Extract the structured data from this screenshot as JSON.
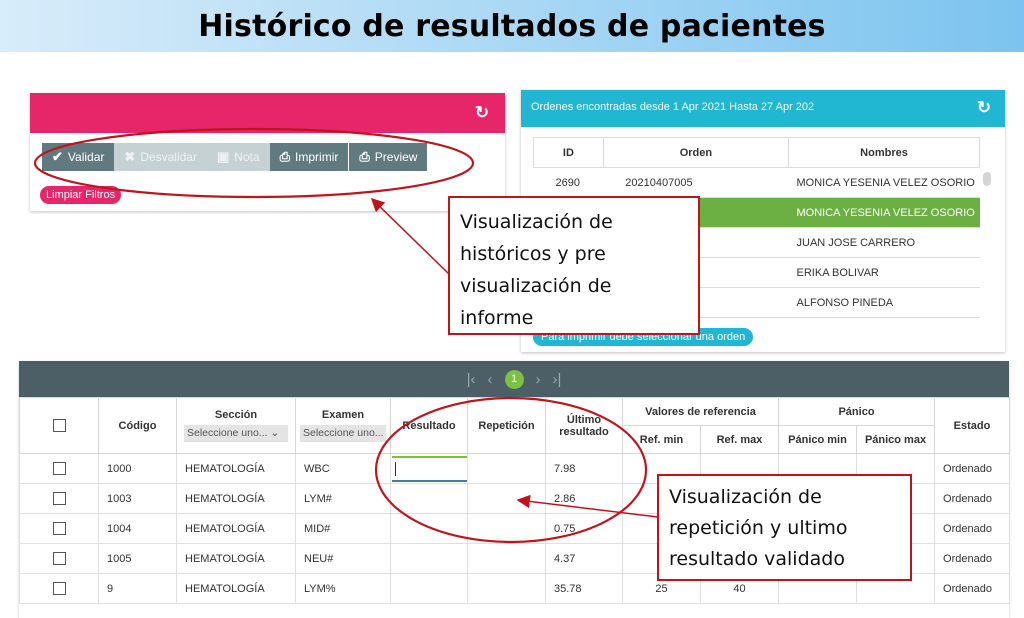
{
  "banner": {
    "title": "Histórico de resultados de pacientes"
  },
  "left_panel": {
    "buttons": [
      {
        "label": "Validar",
        "icon": "check-icon",
        "state": "enabled"
      },
      {
        "label": "Desvalidar",
        "icon": "x-icon",
        "state": "disabled"
      },
      {
        "label": "Nota",
        "icon": "note-icon",
        "state": "disabled"
      },
      {
        "label": "Imprimir",
        "icon": "printer-icon",
        "state": "enabled"
      },
      {
        "label": "Preview",
        "icon": "printer-icon",
        "state": "enabled"
      }
    ],
    "clear_filters": "Limpiar Filtros",
    "header_color": "#e7266a"
  },
  "right_panel": {
    "header_text": "Ordenes encontradas desde 1 Apr 2021 Hasta 27 Apr 202",
    "header_color": "#21b6d2",
    "columns": [
      "ID",
      "Orden",
      "Nombres"
    ],
    "rows": [
      {
        "id": "2690",
        "orden": "20210407005",
        "nombre": "MONICA YESENIA VELEZ OSORIO",
        "selected": false
      },
      {
        "id": "",
        "orden": "",
        "nombre": "MONICA YESENIA VELEZ OSORIO",
        "selected": true
      },
      {
        "id": "",
        "orden": "",
        "nombre": "JUAN JOSE CARRERO",
        "selected": false
      },
      {
        "id": "",
        "orden": "",
        "nombre": "ERIKA BOLIVAR",
        "selected": false
      },
      {
        "id": "",
        "orden": "",
        "nombre": "ALFONSO PINEDA",
        "selected": false
      }
    ],
    "print_hint": "Para imprimir debe seleccionar una orden"
  },
  "pager": {
    "first": "|‹",
    "prev": "‹",
    "current": "1",
    "next": "›",
    "last": "›|"
  },
  "results": {
    "headers": {
      "codigo": "Código",
      "seccion": "Sección",
      "examen": "Examen",
      "resultado": "Resultado",
      "repeticion": "Repetición",
      "ultimo": "Último resultado",
      "ref_group": "Valores de referencia",
      "ref_min": "Ref. min",
      "ref_max": "Ref. max",
      "panico_group": "Pánico",
      "panico_min": "Pánico min",
      "panico_max": "Pánico max",
      "estado": "Estado"
    },
    "seccion_placeholder": "Seleccione uno...",
    "examen_placeholder": "Seleccione uno...",
    "rows": [
      {
        "codigo": "1000",
        "seccion": "HEMATOLOGÍA",
        "examen": "WBC",
        "resultado": "",
        "repeticion": "",
        "ultimo": "7.98",
        "ref_min": "",
        "ref_max": "",
        "panico_min": "",
        "panico_max": "",
        "estado": "Ordenado"
      },
      {
        "codigo": "1003",
        "seccion": "HEMATOLOGÍA",
        "examen": "LYM#",
        "resultado": "",
        "repeticion": "",
        "ultimo": "2.86",
        "ref_min": "",
        "ref_max": "",
        "panico_min": "",
        "panico_max": "",
        "estado": "Ordenado"
      },
      {
        "codigo": "1004",
        "seccion": "HEMATOLOGÍA",
        "examen": "MID#",
        "resultado": "",
        "repeticion": "",
        "ultimo": "0.75",
        "ref_min": "",
        "ref_max": "",
        "panico_min": "",
        "panico_max": "",
        "estado": "Ordenado"
      },
      {
        "codigo": "1005",
        "seccion": "HEMATOLOGÍA",
        "examen": "NEU#",
        "resultado": "",
        "repeticion": "",
        "ultimo": "4.37",
        "ref_min": "",
        "ref_max": "",
        "panico_min": "",
        "panico_max": "",
        "estado": "Ordenado"
      },
      {
        "codigo": "9",
        "seccion": "HEMATOLOGÍA",
        "examen": "LYM%",
        "resultado": "",
        "repeticion": "",
        "ultimo": "35.78",
        "ref_min": "25",
        "ref_max": "40",
        "panico_min": "",
        "panico_max": "",
        "estado": "Ordenado"
      }
    ]
  },
  "annotations": {
    "callout_1": [
      "Visualización de",
      "históricos y pre",
      "visualización de",
      "informe"
    ],
    "callout_2": [
      "Visualización de",
      "repetición y ultimo",
      "resultado validado"
    ],
    "color": "#c0141c"
  }
}
